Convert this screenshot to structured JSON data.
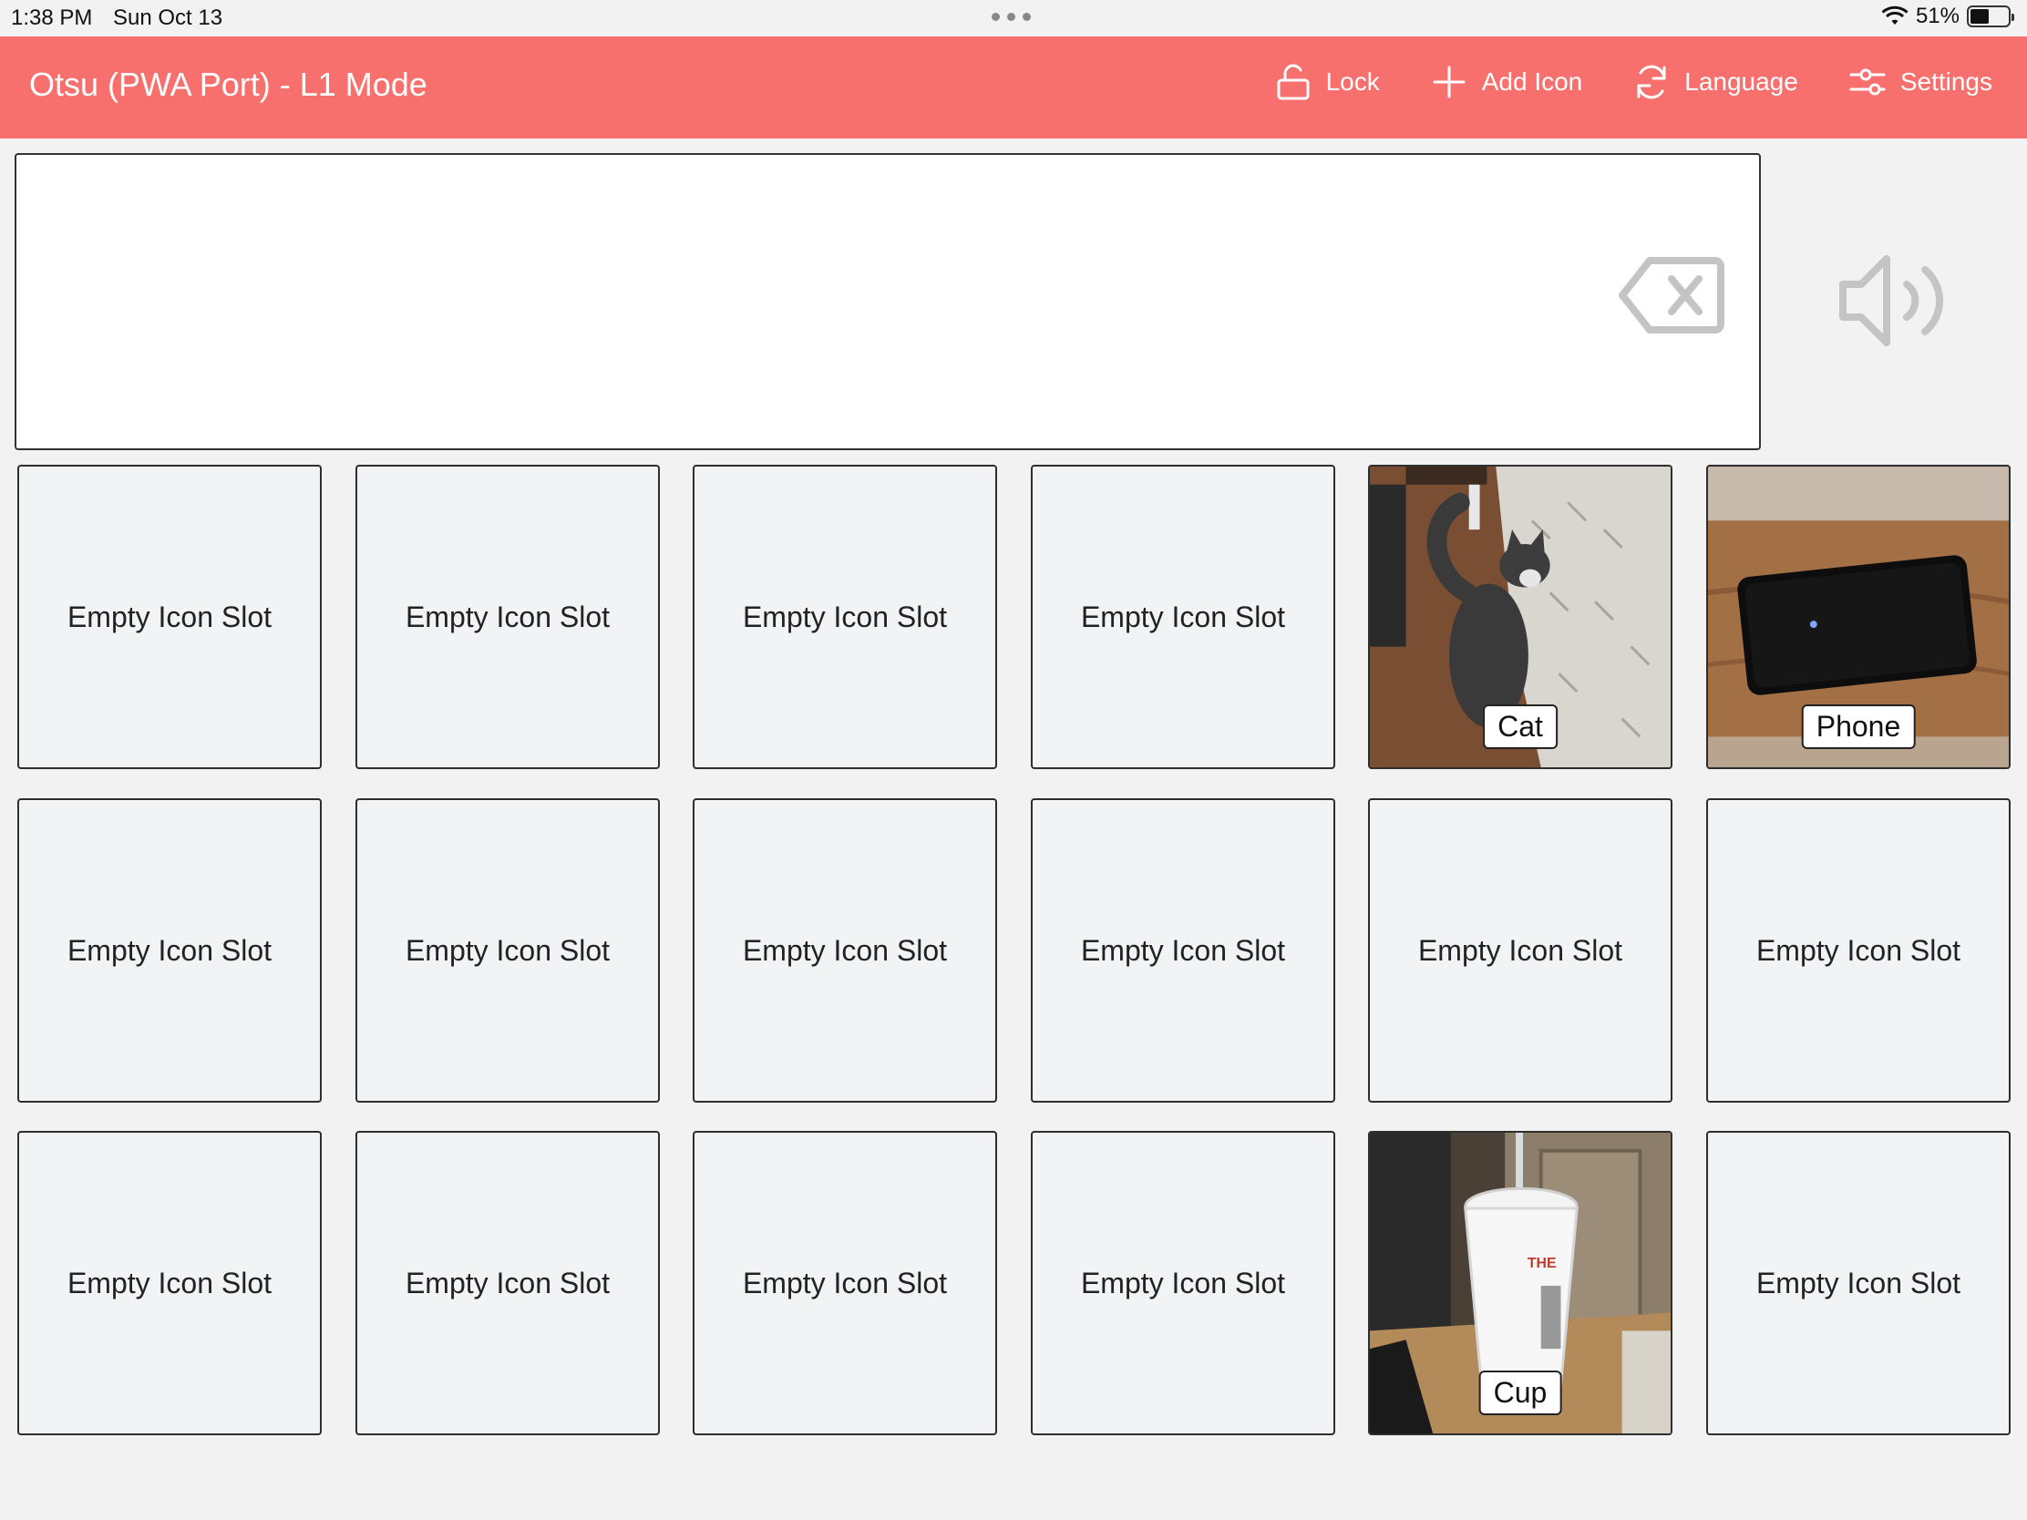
{
  "status_bar": {
    "time": "1:38 PM",
    "date": "Sun Oct 13",
    "battery_percent": "51%",
    "battery_level": 0.51
  },
  "header": {
    "title": "Otsu (PWA Port) - L1 Mode",
    "actions": [
      {
        "label": "Lock",
        "icon": "unlock-icon"
      },
      {
        "label": "Add Icon",
        "icon": "plus-icon"
      },
      {
        "label": "Language",
        "icon": "refresh-icon"
      },
      {
        "label": "Settings",
        "icon": "sliders-icon"
      }
    ]
  },
  "sentence": {
    "text": "",
    "backspace_icon": "backspace-icon",
    "speak_icon": "speaker-icon"
  },
  "grid": {
    "empty_label": "Empty Icon Slot",
    "tiles": [
      {
        "label": "Empty Icon Slot"
      },
      {
        "label": "Empty Icon Slot"
      },
      {
        "label": "Empty Icon Slot"
      },
      {
        "label": "Empty Icon Slot"
      },
      {
        "label": "Cat",
        "photo": "cat"
      },
      {
        "label": "Phone",
        "photo": "phone"
      },
      {
        "label": "Empty Icon Slot"
      },
      {
        "label": "Empty Icon Slot"
      },
      {
        "label": "Empty Icon Slot"
      },
      {
        "label": "Empty Icon Slot"
      },
      {
        "label": "Empty Icon Slot"
      },
      {
        "label": "Empty Icon Slot"
      },
      {
        "label": "Empty Icon Slot"
      },
      {
        "label": "Empty Icon Slot"
      },
      {
        "label": "Empty Icon Slot"
      },
      {
        "label": "Empty Icon Slot"
      },
      {
        "label": "Cup",
        "photo": "cup"
      },
      {
        "label": "Empty Icon Slot"
      }
    ]
  },
  "colors": {
    "header": "#f7706d",
    "background": "#f2f2f2",
    "tile": "#f2f3f4"
  }
}
